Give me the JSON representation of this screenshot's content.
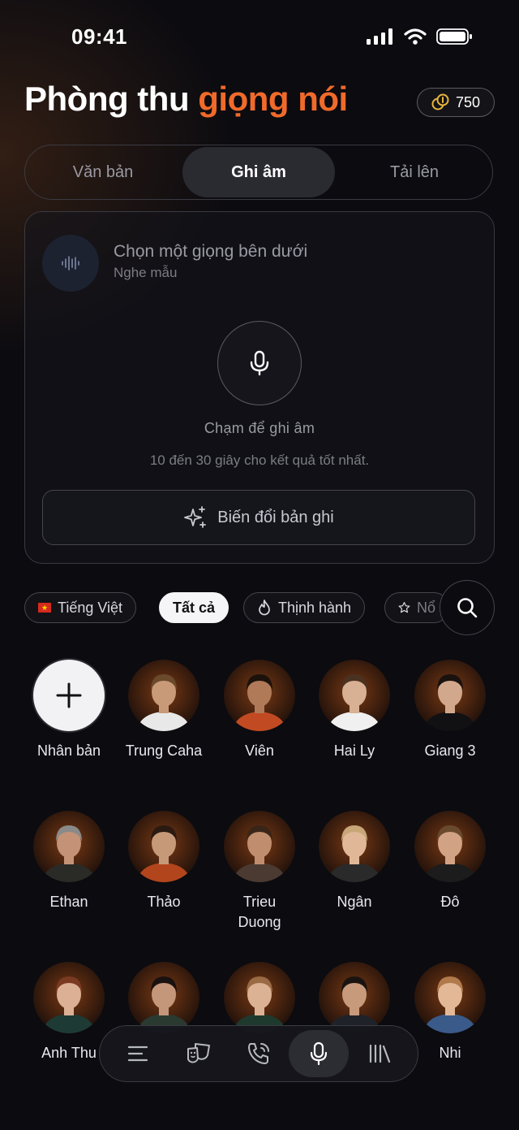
{
  "status": {
    "time": "09:41"
  },
  "header": {
    "title_main": "Phòng thu ",
    "title_accent": "giọng nói",
    "credits": "750"
  },
  "tabs": [
    {
      "label": "Văn bản",
      "active": false
    },
    {
      "label": "Ghi âm",
      "active": true
    },
    {
      "label": "Tải lên",
      "active": false
    }
  ],
  "recorder": {
    "voice_title": "Chọn một giọng bên dưới",
    "voice_sub": "Nghe mẫu",
    "tap_text": "Chạm để ghi âm",
    "hint_text": "10 đến 30 giây cho kết quả tốt nhất.",
    "convert_label": "Biến đổi bản ghi"
  },
  "filters": {
    "language": "Tiếng Việt",
    "all": "Tất cả",
    "trending": "Thịnh hành",
    "featured": "Nổ"
  },
  "voices": [
    {
      "name": "Nhân bản",
      "type": "add"
    },
    {
      "name": "Trung Caha",
      "skin": "#c99a78",
      "hair": "#6b4a2c",
      "shirt": "#e8e8e8"
    },
    {
      "name": "Viên",
      "skin": "#b07a58",
      "hair": "#1c120c",
      "shirt": "#c24a22"
    },
    {
      "name": "Hai Ly",
      "skin": "#d8b094",
      "hair": "#4a3220",
      "shirt": "#f0f0f0"
    },
    {
      "name": "Giang 3",
      "skin": "#d2a88c",
      "hair": "#1a120e",
      "shirt": "#111114"
    },
    {
      "name": "Ethan",
      "skin": "#c49276",
      "hair": "#8a8a88",
      "shirt": "#2a2a26"
    },
    {
      "name": "Thảo",
      "skin": "#c69a78",
      "hair": "#2a1a12",
      "shirt": "#b2451c"
    },
    {
      "name": "Trieu Duong",
      "skin": "#c08e6e",
      "hair": "#3a2618",
      "shirt": "#4a3a32"
    },
    {
      "name": "Ngân",
      "skin": "#e0b898",
      "hair": "#c8a678",
      "shirt": "#2a2a2a"
    },
    {
      "name": "Đô",
      "skin": "#d2a284",
      "hair": "#6a4a2e",
      "shirt": "#1c1c1c"
    },
    {
      "name": "Anh Thu",
      "skin": "#dcb094",
      "hair": "#7a3a22",
      "shirt": "#1e3a34"
    },
    {
      "name": "",
      "skin": "#c4967a",
      "hair": "#1a1210",
      "shirt": "#2a3a30"
    },
    {
      "name": "",
      "skin": "#dcb294",
      "hair": "#9a6a44",
      "shirt": "#1e3a2e"
    },
    {
      "name": "",
      "skin": "#c89a7c",
      "hair": "#1a1410",
      "shirt": "#20222a"
    },
    {
      "name": "Nhi",
      "skin": "#e2b896",
      "hair": "#b07a4a",
      "shirt": "#3a5a8a"
    }
  ],
  "icons": {
    "credits": "coin-icon",
    "voice_avatar": "waveform-icon",
    "mic": "microphone-icon",
    "convert": "sparkles-icon",
    "trending": "flame-icon",
    "featured": "star-icon",
    "search": "search-icon"
  },
  "nav": [
    "menu-icon",
    "theater-masks-icon",
    "phone-call-icon",
    "microphone-icon",
    "library-icon"
  ],
  "colors": {
    "accent": "#f06a2a",
    "background": "#0b0b10"
  }
}
